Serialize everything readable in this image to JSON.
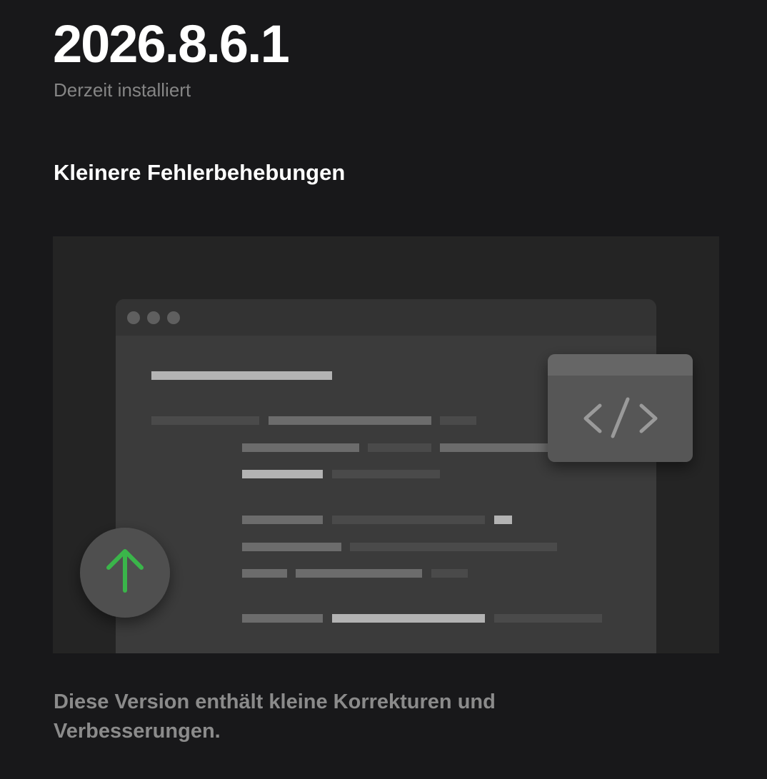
{
  "release": {
    "version": "2026.8.6.1",
    "status": "Derzeit installiert",
    "headline": "Kleinere Fehlerbehebungen",
    "description": "Diese Version enthält kleine Korrekturen und Verbesserungen."
  },
  "illustration": {
    "icons": [
      "window-dots-icon",
      "code-icon",
      "arrow-up-icon"
    ],
    "colors": {
      "background": "#18181a",
      "panel": "#242424",
      "window": "#3b3b3b",
      "code_card": "#575757",
      "accent_green": "#3ab54a"
    }
  }
}
